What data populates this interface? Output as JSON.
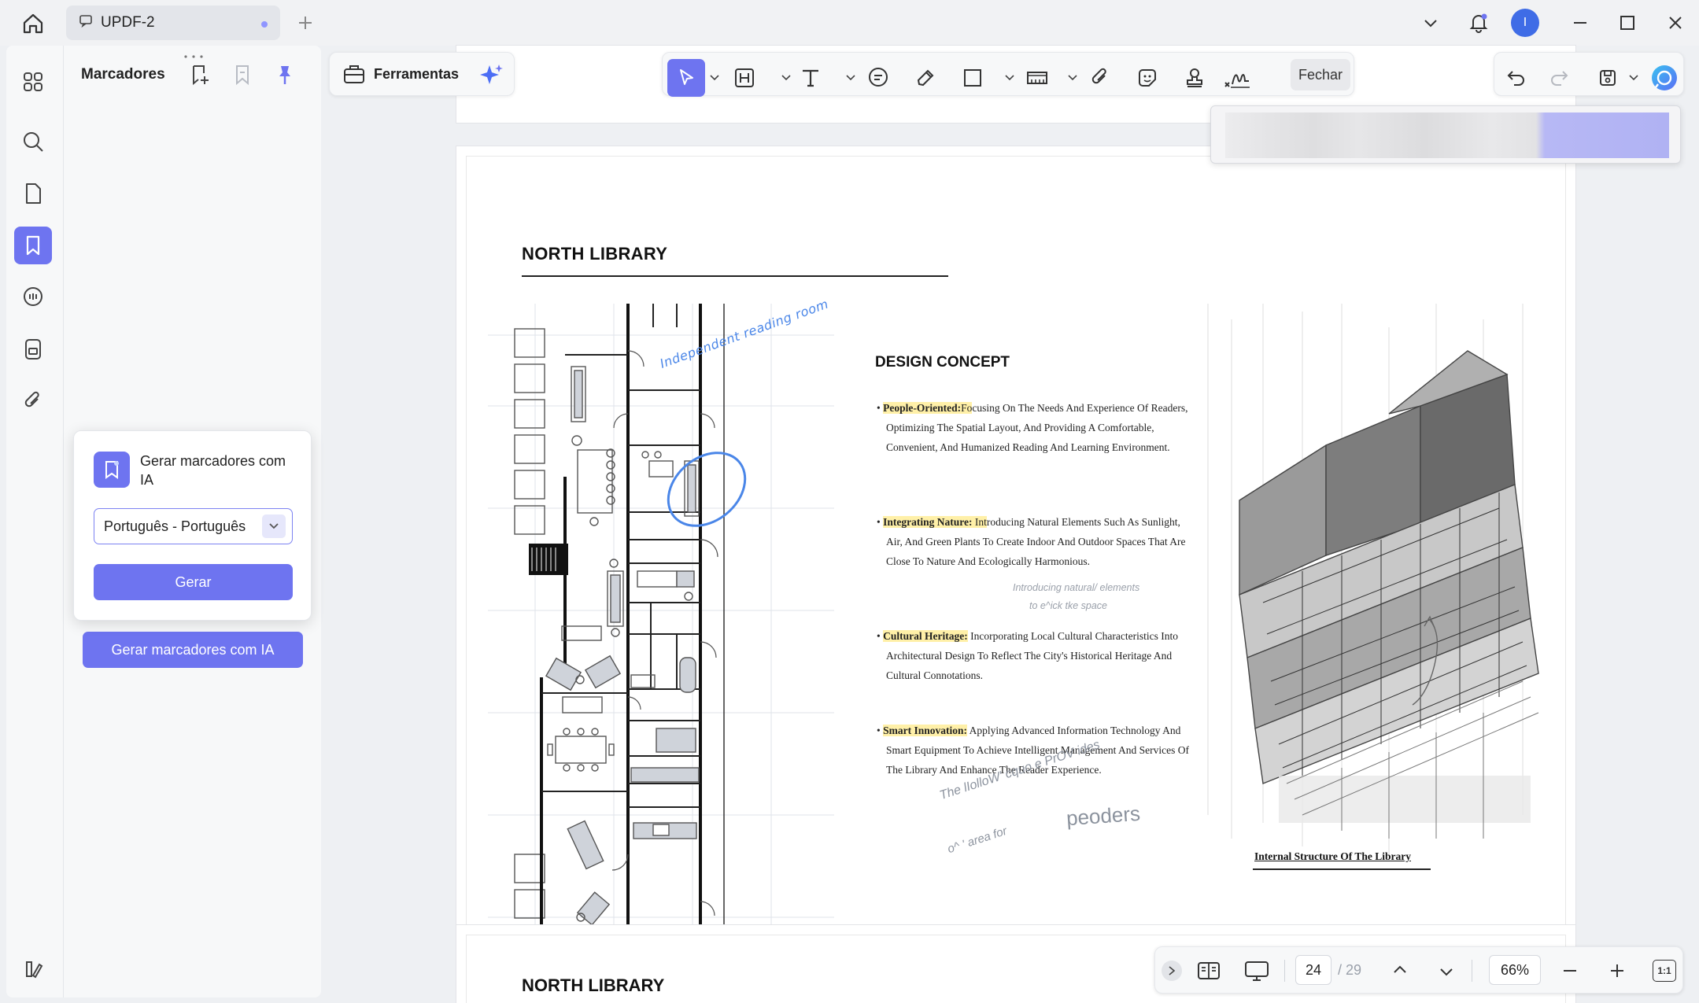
{
  "titlebar": {
    "tab_title": "UPDF-2",
    "avatar_initial": "I"
  },
  "bookmarks": {
    "title": "Marcadores",
    "popup_title": "Gerar marcadores com IA",
    "language_value": "Português - Português",
    "generate_label": "Gerar",
    "ai_button_label": "Gerar marcadores com IA"
  },
  "toolbar": {
    "tools_label": "Ferramentas",
    "close_label": "Fechar"
  },
  "document": {
    "page1": {
      "heading": "NORTH LIBRARY",
      "concept_title": "DESIGN CONCEPT",
      "b1_key": "People-Oriented:",
      "b1_hl_tail": "Fo",
      "b1_text": "cusing On The        Needs And Experience Of Readers, Optimizing The Spatial Layout, And Providing A Comfortable, Convenient, And Humanized Reading And Learning Environment.",
      "b2_key": "Integrating Nature:",
      "b2_hl_tail": " Int",
      "b2_text": "roducing Natural Elements Such As Sunlight, Air, And Green Plants To Create Indoor And Outdoor Spaces That Are Close To Nature And Ecologically Harmonious.",
      "b2_note": "Introducing natural/ elements",
      "b2_note2": "to e^ick tke space",
      "b3_key": "Cultural Heritage:",
      "b3_text": " Incorporating Local Cultural Characteristics Into Architectural Design To Reflect The City's Historical Heritage And Cultural Connotations.",
      "b4_key": "Smart Innovation:",
      "b4_text": " Applying Advanced Information Technology And Smart Equipment To Achieve Intelligent Management And Services Of The Library And Enhance The Reader Experience.",
      "annotation_room": "Independent reading room",
      "caption": "Internal Structure Of The Library",
      "hand_line1": "The lIolloW' cquo e PrOV ides",
      "hand_line2": "peoders",
      "hand_line3": "o^    ' area for"
    },
    "page2": {
      "heading": "NORTH LIBRARY"
    }
  },
  "bottombar": {
    "page_current": "24",
    "page_total": "/ 29",
    "zoom": "66%",
    "fit_label": "1:1"
  },
  "colors": {
    "accent": "#6e74f0",
    "annotation_blue": "#4a86e8",
    "highlight": "#fff0a8"
  }
}
